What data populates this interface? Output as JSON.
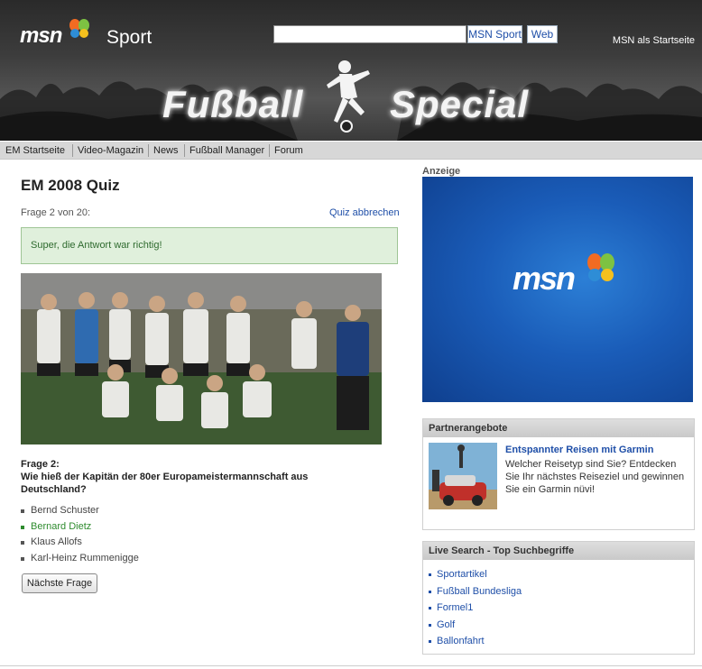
{
  "header": {
    "logo": "msn",
    "section": "Sport",
    "search": {
      "value": "",
      "placeholder": ""
    },
    "search_buttons": [
      "MSN Sport",
      "Web"
    ],
    "startseite_link": "MSN als Startseite",
    "banner_title_left": "Fußball",
    "banner_title_right": "Special",
    "logo_colors": [
      "#f26b22",
      "#7dc242",
      "#2e8dd6",
      "#f4c01e"
    ]
  },
  "nav": {
    "items": [
      "EM Startseite",
      "Video-Magazin",
      "News",
      "Fußball Manager",
      "Forum"
    ]
  },
  "quiz": {
    "title": "EM 2008 Quiz",
    "progress": "Frage 2 von 20:",
    "cancel_link": "Quiz abbrechen",
    "result_message": "Super, die Antwort war richtig!",
    "question_label": "Frage 2:",
    "question_text": "Wie hieß der Kapitän der 80er Europameistermannschaft aus Deutschland?",
    "answers": [
      {
        "text": "Bernd Schuster",
        "correct": false
      },
      {
        "text": "Bernard Dietz",
        "correct": true
      },
      {
        "text": "Klaus Allofs",
        "correct": false
      },
      {
        "text": "Karl-Heinz Rummenigge",
        "correct": false
      }
    ],
    "next_button": "Nächste Frage"
  },
  "sidebar": {
    "ad_label": "Anzeige",
    "ad_logo": "msn",
    "partner": {
      "heading": "Partnerangebote",
      "title": "Entspannter Reisen mit Garmin",
      "text": "Welcher Reisetyp sind Sie? Entdecken Sie Ihr nächstes Reiseziel und gewinnen Sie ein Garmin nüvi!"
    },
    "live_search": {
      "heading": "Live Search - Top Suchbegriffe",
      "items": [
        "Sportartikel",
        "Fußball Bundesliga",
        "Formel1",
        "Golf",
        "Ballonfahrt"
      ]
    }
  },
  "colors": {
    "correct_green": "#2e8b2e",
    "link_blue": "#1f4fa8",
    "result_bg": "#e0f0dc",
    "ad_blue": "#1a5cb8"
  }
}
